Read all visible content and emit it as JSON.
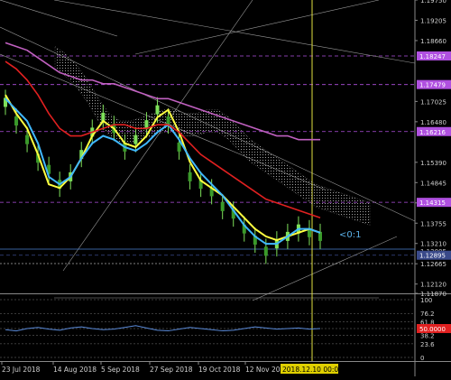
{
  "chart_data": [
    {
      "type": "line",
      "title": "",
      "xlabel": "",
      "ylabel": "",
      "ylim": [
        1.1187,
        1.1975
      ],
      "price_ticks": [
        "1.19750",
        "1.19205",
        "1.18660",
        "1.18115",
        "1.17570",
        "1.17025",
        "1.16480",
        "1.15935",
        "1.15390",
        "1.14845",
        "1.14300",
        "1.13755",
        "1.13210",
        "1.12665",
        "1.12120",
        "1.11870"
      ],
      "hidden_ticks": [
        "1.18115",
        "1.17570",
        "1.15935"
      ],
      "level_badges": [
        {
          "label": "1.18247",
          "value": 1.18247,
          "color": "#b050e0"
        },
        {
          "label": "1.17479",
          "value": 1.17479,
          "color": "#b050e0"
        },
        {
          "label": "1.16216",
          "value": 1.16216,
          "color": "#b050e0"
        },
        {
          "label": "1.14315",
          "value": 1.14315,
          "color": "#b050e0"
        },
        {
          "label": "1.12895",
          "value": 1.12895,
          "color": "#3a4a8a"
        }
      ],
      "current_price_label": "1.13005",
      "annotation": "<0:1",
      "annotation_color": "#5ab0e8",
      "vertical_marker_color": "#e0e040",
      "x_dates": [
        "23 Jul 2018",
        "14 Aug 2018",
        "5 Sep 2018",
        "27 Sep 2018",
        "19 Oct 2018",
        "12 Nov 2018"
      ],
      "x_highlight_label": "2018.12.10 00:00",
      "x_highlight_color": "#e0d000",
      "series": [
        {
          "color": "#ffff40",
          "values": [
            1.172,
            1.167,
            1.163,
            1.156,
            1.148,
            1.147,
            1.15,
            1.155,
            1.161,
            1.165,
            1.163,
            1.159,
            1.158,
            1.161,
            1.166,
            1.168,
            1.162,
            1.154,
            1.149,
            1.147,
            1.145,
            1.142,
            1.139,
            1.136,
            1.134,
            1.133,
            1.134,
            1.135,
            1.136,
            1.135
          ]
        },
        {
          "color": "#40b8ff",
          "values": [
            1.171,
            1.168,
            1.165,
            1.159,
            1.15,
            1.148,
            1.15,
            1.155,
            1.159,
            1.161,
            1.16,
            1.158,
            1.157,
            1.159,
            1.162,
            1.164,
            1.16,
            1.155,
            1.151,
            1.148,
            1.145,
            1.141,
            1.137,
            1.134,
            1.132,
            1.132,
            1.134,
            1.136,
            1.136,
            1.135
          ]
        },
        {
          "color": "#e02020",
          "values": [
            1.181,
            1.179,
            1.176,
            1.172,
            1.167,
            1.163,
            1.161,
            1.161,
            1.162,
            1.163,
            1.164,
            1.164,
            1.163,
            1.163,
            1.164,
            1.164,
            1.162,
            1.159,
            1.156,
            1.154,
            1.152,
            1.15,
            1.148,
            1.146,
            1.144,
            1.143,
            1.142,
            1.141,
            1.14,
            1.139
          ]
        },
        {
          "color": "#c060c0",
          "values": [
            1.186,
            1.185,
            1.184,
            1.182,
            1.18,
            1.178,
            1.177,
            1.176,
            1.176,
            1.175,
            1.175,
            1.174,
            1.173,
            1.172,
            1.171,
            1.171,
            1.17,
            1.169,
            1.168,
            1.167,
            1.166,
            1.165,
            1.164,
            1.163,
            1.162,
            1.161,
            1.161,
            1.16,
            1.16,
            1.16
          ]
        }
      ],
      "candles": [
        1.17,
        1.165,
        1.16,
        1.155,
        1.152,
        1.148,
        1.15,
        1.156,
        1.162,
        1.166,
        1.163,
        1.158,
        1.16,
        1.164,
        1.168,
        1.165,
        1.158,
        1.15,
        1.148,
        1.146,
        1.142,
        1.14,
        1.136,
        1.133,
        1.13,
        1.132,
        1.134,
        1.136,
        1.135,
        1.134
      ]
    },
    {
      "type": "line",
      "title": "",
      "xlabel": "",
      "ylabel": "",
      "ylim": [
        0,
        100
      ],
      "ticks": [
        "100",
        "76.2",
        "61.8",
        "50",
        "38.2",
        "23.6",
        "0"
      ],
      "highlight_tick": {
        "label": "50.0000",
        "color": "#e02020"
      },
      "series": [
        {
          "color": "#5a8ad8",
          "values": [
            48,
            46,
            50,
            52,
            49,
            47,
            51,
            53,
            50,
            48,
            49,
            52,
            55,
            51,
            47,
            46,
            49,
            52,
            50,
            48,
            46,
            47,
            50,
            53,
            51,
            49,
            50,
            51,
            49,
            50
          ]
        }
      ]
    }
  ]
}
